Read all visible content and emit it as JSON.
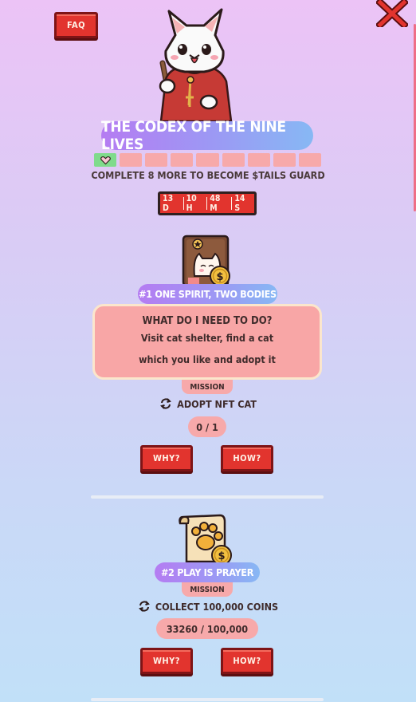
{
  "header": {
    "faq_label": "FAQ",
    "title": "THE CODEX OF THE NINE LIVES"
  },
  "progress": {
    "completed": 1,
    "total": 9,
    "caption": "COMPLETE 8 MORE TO BECOME $TAILS GUARD"
  },
  "timer": {
    "days": "13 D",
    "hours": "10 H",
    "minutes": "48 M",
    "seconds": "14 S"
  },
  "quests": [
    {
      "title": "#1 ONE SPIRIT, TWO BODIES",
      "question": "WHAT DO I NEED TO DO?",
      "answer": "Visit cat shelter, find a cat which you like and adopt it",
      "mission_label": "MISSION",
      "mission_text": "ADOPT NFT CAT",
      "count": "0 / 1",
      "why_label": "WHY?",
      "how_label": "HOW?",
      "icon": "cat-book-coin-icon"
    },
    {
      "title": "#2 PLAY IS PRAYER",
      "mission_label": "MISSION",
      "mission_text": "COLLECT 100,000 COINS",
      "count": "33260 / 100,000",
      "why_label": "WHY?",
      "how_label": "HOW?",
      "icon": "paw-scroll-coin-icon"
    }
  ],
  "colors": {
    "button_red": "#e2342e",
    "pill_pink": "#f7a9aa",
    "done_green": "#7fdb8c",
    "pill_gradient_start": "#b57cf2",
    "pill_gradient_end": "#87b8f4"
  }
}
